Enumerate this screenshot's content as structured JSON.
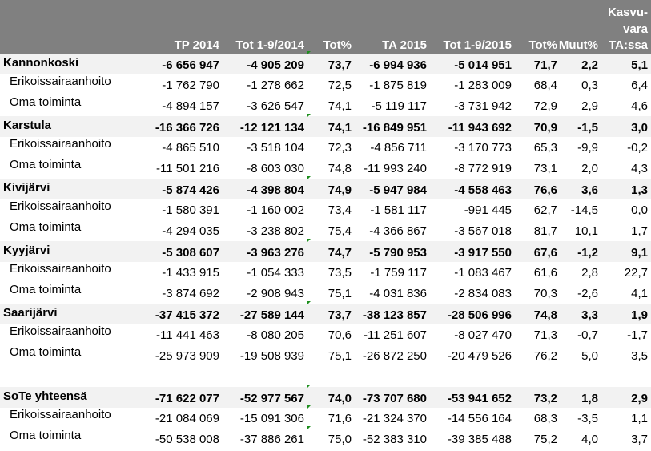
{
  "columns": {
    "tp2014": "TP 2014",
    "tot2014": "Tot 1-9/2014",
    "totpct2014": "Tot%",
    "ta2015": "TA 2015",
    "tot2015": "Tot 1-9/2015",
    "totpct2015": "Tot%",
    "muutpct": "Muut%",
    "kasvuvara_line1": "Kasvu-",
    "kasvuvara_line2": "vara",
    "kasvuvara_line3": "TA:ssa"
  },
  "rows": [
    {
      "type": "group",
      "name": "Kannonkoski",
      "values": [
        "-6 656 947",
        "-4 905 209",
        "73,7",
        "-6 994 936",
        "-5 014 951",
        "71,7",
        "2,2",
        "5,1"
      ]
    },
    {
      "type": "sub",
      "name": "Erikoissairaanhoito",
      "values": [
        "-1 762 790",
        "-1 278 662",
        "72,5",
        "-1 875 819",
        "-1 283 009",
        "68,4",
        "0,3",
        "6,4"
      ]
    },
    {
      "type": "sub",
      "name": "Oma toiminta",
      "values": [
        "-4 894 157",
        "-3 626 547",
        "74,1",
        "-5 119 117",
        "-3 731 942",
        "72,9",
        "2,9",
        "4,6"
      ]
    },
    {
      "type": "group",
      "name": "Karstula",
      "values": [
        "-16 366 726",
        "-12 121 134",
        "74,1",
        "-16 849 951",
        "-11 943 692",
        "70,9",
        "-1,5",
        "3,0"
      ]
    },
    {
      "type": "sub",
      "name": "Erikoissairaanhoito",
      "values": [
        "-4 865 510",
        "-3 518 104",
        "72,3",
        "-4 856 711",
        "-3 170 773",
        "65,3",
        "-9,9",
        "-0,2"
      ]
    },
    {
      "type": "sub",
      "name": "Oma toiminta",
      "values": [
        "-11 501 216",
        "-8 603 030",
        "74,8",
        "-11 993 240",
        "-8 772 919",
        "73,1",
        "2,0",
        "4,3"
      ]
    },
    {
      "type": "group",
      "name": "Kivijärvi",
      "values": [
        "-5 874 426",
        "-4 398 804",
        "74,9",
        "-5 947 984",
        "-4 558 463",
        "76,6",
        "3,6",
        "1,3"
      ]
    },
    {
      "type": "sub",
      "name": "Erikoissairaanhoito",
      "values": [
        "-1 580 391",
        "-1 160 002",
        "73,4",
        "-1 581 117",
        "-991 445",
        "62,7",
        "-14,5",
        "0,0"
      ]
    },
    {
      "type": "sub",
      "name": "Oma toiminta",
      "values": [
        "-4 294 035",
        "-3 238 802",
        "75,4",
        "-4 366 867",
        "-3 567 018",
        "81,7",
        "10,1",
        "1,7"
      ]
    },
    {
      "type": "group",
      "name": "Kyyjärvi",
      "values": [
        "-5 308 607",
        "-3 963 276",
        "74,7",
        "-5 790 953",
        "-3 917 550",
        "67,6",
        "-1,2",
        "9,1"
      ]
    },
    {
      "type": "sub",
      "name": "Erikoissairaanhoito",
      "values": [
        "-1 433 915",
        "-1 054 333",
        "73,5",
        "-1 759 117",
        "-1 083 467",
        "61,6",
        "2,8",
        "22,7"
      ]
    },
    {
      "type": "sub",
      "name": "Oma toiminta",
      "values": [
        "-3 874 692",
        "-2 908 943",
        "75,1",
        "-4 031 836",
        "-2 834 083",
        "70,3",
        "-2,6",
        "4,1"
      ]
    },
    {
      "type": "group",
      "name": "Saarijärvi",
      "values": [
        "-37 415 372",
        "-27 589 144",
        "73,7",
        "-38 123 857",
        "-28 506 996",
        "74,8",
        "3,3",
        "1,9"
      ]
    },
    {
      "type": "sub",
      "name": "Erikoissairaanhoito",
      "values": [
        "-11 441 463",
        "-8 080 205",
        "70,6",
        "-11 251 607",
        "-8 027 470",
        "71,3",
        "-0,7",
        "-1,7"
      ]
    },
    {
      "type": "sub",
      "name": "Oma toiminta",
      "values": [
        "-25 973 909",
        "-19 508 939",
        "75,1",
        "-26 872 250",
        "-20 479 526",
        "76,2",
        "5,0",
        "3,5"
      ]
    },
    {
      "type": "blank",
      "name": "",
      "values": []
    },
    {
      "type": "group",
      "name": "SoTe yhteensä",
      "values": [
        "-71 622 077",
        "-52 977 567",
        "74,0",
        "-73 707 680",
        "-53 941 652",
        "73,2",
        "1,8",
        "2,9"
      ]
    },
    {
      "type": "sub",
      "name": "Erikoissairaanhoito",
      "values": [
        "-21 084 069",
        "-15 091 306",
        "71,6",
        "-21 324 370",
        "-14 556 164",
        "68,3",
        "-3,5",
        "1,1"
      ]
    },
    {
      "type": "sub",
      "name": "Oma toiminta",
      "values": [
        "-50 538 008",
        "-37 886 261",
        "75,0",
        "-52 383 310",
        "-39 385 488",
        "75,2",
        "4,0",
        "3,7"
      ]
    }
  ],
  "colors": {
    "header_bg": "#808080",
    "group_row_bg": "#f2f2f2",
    "comment_marker": "#1e8f1e"
  }
}
